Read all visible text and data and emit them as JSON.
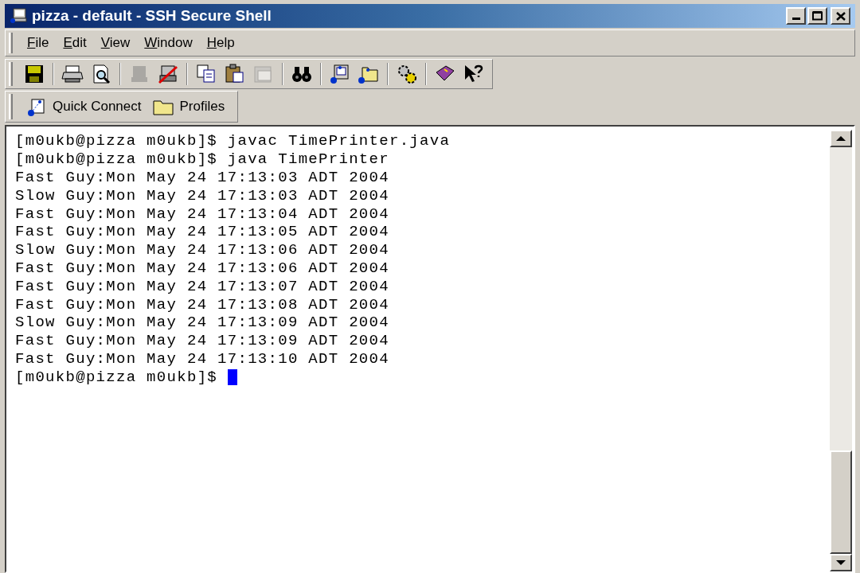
{
  "window": {
    "title": "pizza - default - SSH Secure Shell"
  },
  "menu": [
    "File",
    "Edit",
    "View",
    "Window",
    "Help"
  ],
  "toolbar": [
    {
      "kind": "save",
      "disabled": false
    },
    {
      "kind": "sep"
    },
    {
      "kind": "print",
      "disabled": false
    },
    {
      "kind": "preview",
      "disabled": false
    },
    {
      "kind": "sep"
    },
    {
      "kind": "connect",
      "disabled": true
    },
    {
      "kind": "disconnect",
      "disabled": false
    },
    {
      "kind": "sep"
    },
    {
      "kind": "copy",
      "disabled": false
    },
    {
      "kind": "paste",
      "disabled": false
    },
    {
      "kind": "pastesel",
      "disabled": true
    },
    {
      "kind": "sep"
    },
    {
      "kind": "find",
      "disabled": false
    },
    {
      "kind": "sep"
    },
    {
      "kind": "newterm",
      "disabled": false
    },
    {
      "kind": "newfile",
      "disabled": false
    },
    {
      "kind": "sep"
    },
    {
      "kind": "settings",
      "disabled": false
    },
    {
      "kind": "sep"
    },
    {
      "kind": "help",
      "disabled": false
    },
    {
      "kind": "whatsthis",
      "disabled": false
    }
  ],
  "quickbar": [
    {
      "kind": "quick",
      "label": "Quick Connect"
    },
    {
      "kind": "profiles",
      "label": "Profiles"
    }
  ],
  "terminal": {
    "lines": [
      "[m0ukb@pizza m0ukb]$ javac TimePrinter.java",
      "[m0ukb@pizza m0ukb]$ java TimePrinter",
      "Fast Guy:Mon May 24 17:13:03 ADT 2004",
      "Slow Guy:Mon May 24 17:13:03 ADT 2004",
      "Fast Guy:Mon May 24 17:13:04 ADT 2004",
      "Fast Guy:Mon May 24 17:13:05 ADT 2004",
      "Slow Guy:Mon May 24 17:13:06 ADT 2004",
      "Fast Guy:Mon May 24 17:13:06 ADT 2004",
      "Fast Guy:Mon May 24 17:13:07 ADT 2004",
      "Fast Guy:Mon May 24 17:13:08 ADT 2004",
      "Slow Guy:Mon May 24 17:13:09 ADT 2004",
      "Fast Guy:Mon May 24 17:13:09 ADT 2004",
      "Fast Guy:Mon May 24 17:13:10 ADT 2004",
      "[m0ukb@pizza m0ukb]$"
    ]
  }
}
